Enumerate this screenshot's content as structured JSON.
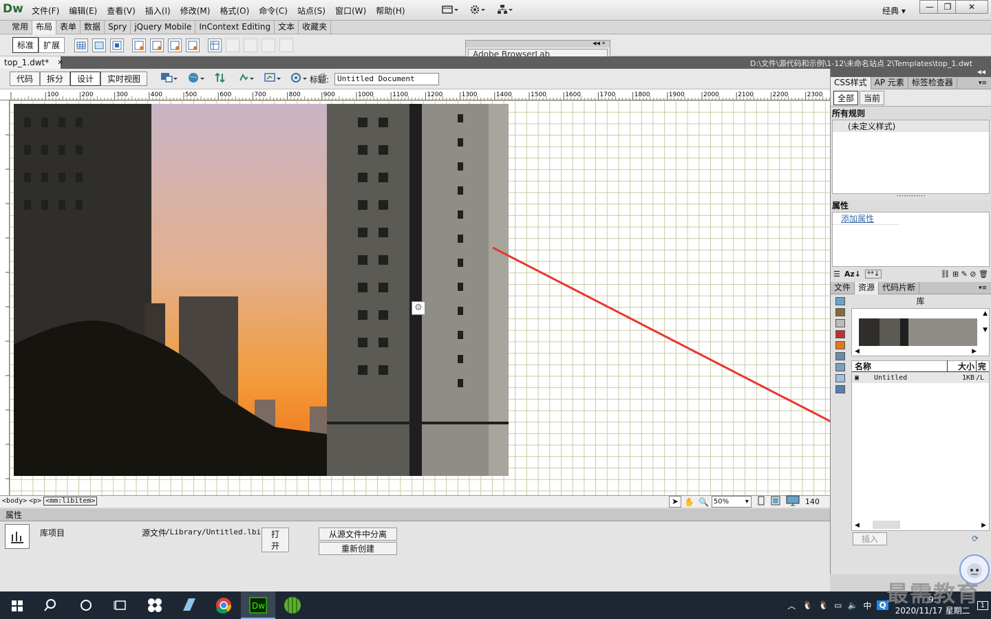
{
  "app": {
    "logo": "Dw",
    "menu": [
      "文件(F)",
      "编辑(E)",
      "查看(V)",
      "插入(I)",
      "修改(M)",
      "格式(O)",
      "命令(C)",
      "站点(S)",
      "窗口(W)",
      "帮助(H)"
    ],
    "workspace": "经典",
    "win_min": "—",
    "win_max": "❐",
    "win_close": "✕"
  },
  "insert_bar": {
    "tabs": [
      "常用",
      "布局",
      "表单",
      "数据",
      "Spry",
      "jQuery Mobile",
      "InContext Editing",
      "文本",
      "收藏夹"
    ],
    "active_tab": "布局",
    "mode_buttons": [
      "标准",
      "扩展"
    ]
  },
  "browserlab": {
    "title": "Adobe BrowserLab"
  },
  "document": {
    "tab_label": "top_1.dwt*",
    "tab_close": "✕",
    "path": "D:\\文件\\源代码和示例\\1-12\\未命名站点 2\\Templates\\top_1.dwt",
    "view_buttons": [
      "代码",
      "拆分",
      "设计",
      "实时视图"
    ],
    "active_view": "设计",
    "title_label": "标题:",
    "title_value": "Untitled Document"
  },
  "ruler": {
    "labels": [
      "100",
      "200",
      "300",
      "400",
      "500",
      "600",
      "700",
      "800",
      "900",
      "1000",
      "1100",
      "1200",
      "1300",
      "1400",
      "1500",
      "1600",
      "1700",
      "1800",
      "1900",
      "2000",
      "2100",
      "2200",
      "2300"
    ]
  },
  "status": {
    "tags": [
      "<body>",
      "<p>",
      "<mm:libitem>"
    ],
    "zoom": "50%",
    "width_readout": "140"
  },
  "properties": {
    "header": "属性",
    "item_type": "库项目",
    "src_label": "源文件",
    "src_value": "/Library/Untitled.lbi",
    "open_button": "打开",
    "detach_button": "从源文件中分离",
    "recreate_button": "重新创建"
  },
  "css_panel": {
    "tabs": [
      "CSS样式",
      "AP 元素",
      "标签检查器"
    ],
    "mode_buttons": [
      "全部",
      "当前"
    ],
    "rules_header": "所有规则",
    "rules": [
      "(未定义样式)"
    ],
    "props_header": "属性",
    "add_property": "添加属性"
  },
  "assets_panel": {
    "tabs": [
      "文件",
      "资源",
      "代码片断"
    ],
    "section_title": "库",
    "columns": [
      "名称",
      "大小",
      "完"
    ],
    "items": [
      {
        "name": "Untitled",
        "size": "1KB",
        "path": "/L"
      }
    ],
    "insert_button": "插入"
  },
  "taskbar": {
    "clock_time": "9:",
    "clock_date": "2020/11/17 星期二",
    "ime": "中",
    "notification_count": "1"
  },
  "watermark": "最需教育",
  "colors": {
    "arrow": "#e8372e",
    "grid": "#c9c9a4",
    "dw_green": "#2b6a33"
  }
}
